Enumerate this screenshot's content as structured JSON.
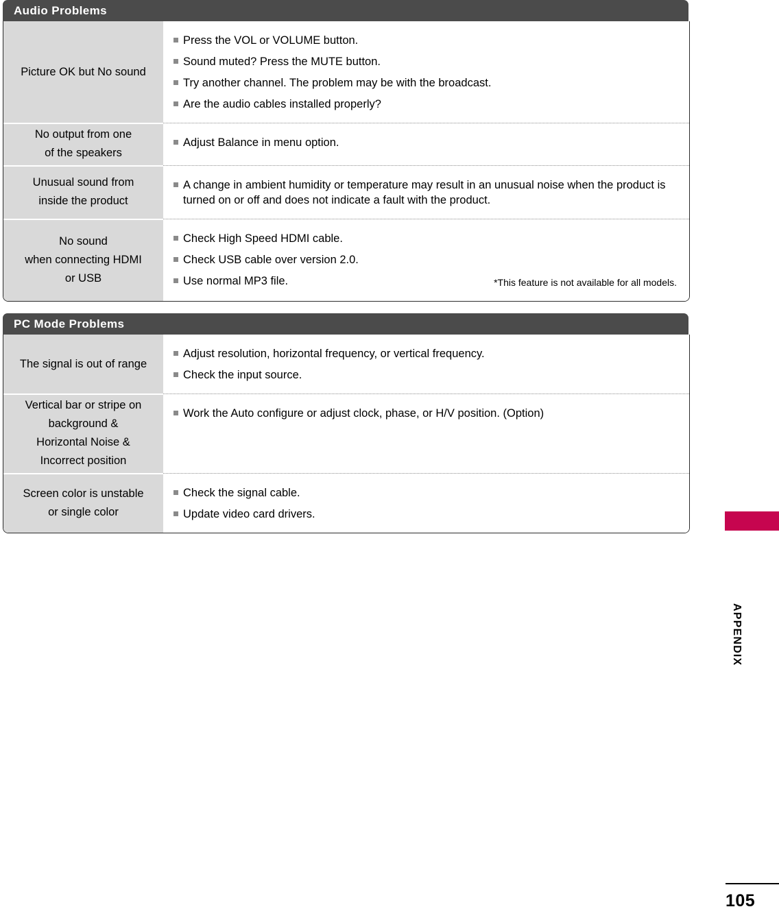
{
  "page": {
    "number": "105",
    "side_label": "APPENDIX"
  },
  "sections": [
    {
      "title": "Audio Problems",
      "rows": [
        {
          "symptom": "Picture OK but No sound",
          "fixes": [
            {
              "text": "Press the VOL or VOLUME button."
            },
            {
              "text": "Sound muted? Press the MUTE button."
            },
            {
              "text": "Try another channel. The problem may be with the broadcast."
            },
            {
              "text": "Are the audio cables installed properly?"
            }
          ]
        },
        {
          "symptom": "No output from one\nof the speakers",
          "fixes": [
            {
              "text": "Adjust Balance in menu option."
            }
          ]
        },
        {
          "symptom": "Unusual sound from\ninside the product",
          "fixes": [
            {
              "text": "A change in ambient humidity or temperature may result in an unusual noise when the product is turned on or off and does not indicate a fault with the product."
            }
          ]
        },
        {
          "symptom": "No sound\nwhen connecting HDMI\nor USB",
          "fixes": [
            {
              "text": "Check High Speed HDMI cable."
            },
            {
              "text": "Check USB cable over version 2.0."
            },
            {
              "text": "Use normal MP3 file.",
              "note": "*This feature is not available for all models."
            }
          ]
        }
      ]
    },
    {
      "title": "PC Mode Problems",
      "rows": [
        {
          "symptom": "The signal is out of range",
          "fixes": [
            {
              "text": "Adjust resolution, horizontal frequency, or vertical frequency."
            },
            {
              "text": "Check the input source."
            }
          ]
        },
        {
          "symptom": "Vertical bar or stripe on\nbackground &\nHorizontal Noise &\nIncorrect position",
          "fixes": [
            {
              "text": "Work the Auto configure or adjust clock, phase, or H/V position. (Option)"
            }
          ]
        },
        {
          "symptom": "Screen color is unstable\nor single color",
          "fixes": [
            {
              "text": "Check the signal cable."
            },
            {
              "text": "Update video card drivers."
            }
          ]
        }
      ]
    }
  ],
  "colors": {
    "header_bar": "#4b4b4b",
    "symptom_cell": "#d9d9d9",
    "bullet": "#8a8a8a",
    "tab_marker": "#c6054f"
  }
}
